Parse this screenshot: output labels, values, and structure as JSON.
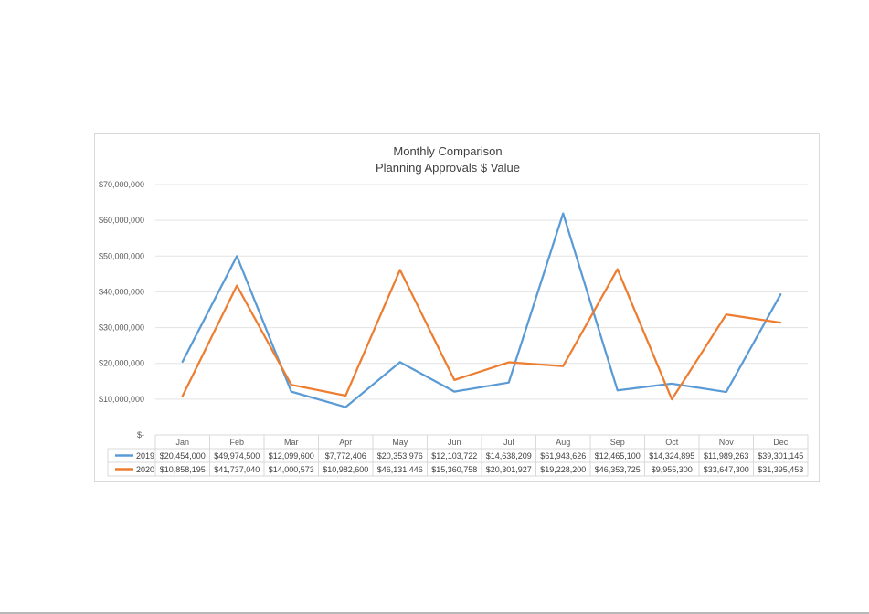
{
  "chart_data": {
    "type": "line",
    "title": "Monthly Comparison",
    "subtitle": "Planning Approvals $ Value",
    "categories": [
      "Jan",
      "Feb",
      "Mar",
      "Apr",
      "May",
      "Jun",
      "Jul",
      "Aug",
      "Sep",
      "Oct",
      "Nov",
      "Dec"
    ],
    "ylim": [
      0,
      70000000
    ],
    "yticks": [
      0,
      10000000,
      20000000,
      30000000,
      40000000,
      50000000,
      60000000,
      70000000
    ],
    "ytick_labels": [
      "$-",
      "$10,000,000",
      "$20,000,000",
      "$30,000,000",
      "$40,000,000",
      "$50,000,000",
      "$60,000,000",
      "$70,000,000"
    ],
    "grid": true,
    "legend": "data-table",
    "series": [
      {
        "name": "2019",
        "color": "#5b9bd5",
        "values": [
          20454000,
          49974500,
          12099600,
          7772406,
          20353976,
          12103722,
          14638209,
          61943626,
          12465100,
          14324895,
          11989263,
          39301145
        ],
        "labels": [
          "$20,454,000",
          "$49,974,500",
          "$12,099,600",
          "$7,772,406",
          "$20,353,976",
          "$12,103,722",
          "$14,638,209",
          "$61,943,626",
          "$12,465,100",
          "$14,324,895",
          "$11,989,263",
          "$39,301,145"
        ]
      },
      {
        "name": "2020",
        "color": "#ed7d31",
        "values": [
          10858195,
          41737040,
          14000573,
          10982600,
          46131446,
          15360758,
          20301927,
          19228200,
          46353725,
          9955300,
          33647300,
          31395453
        ],
        "labels": [
          "$10,858,195",
          "$41,737,040",
          "$14,000,573",
          "$10,982,600",
          "$46,131,446",
          "$15,360,758",
          "$20,301,927",
          "$19,228,200",
          "$46,353,725",
          "$9,955,300",
          "$33,647,300",
          "$31,395,453"
        ]
      }
    ]
  }
}
